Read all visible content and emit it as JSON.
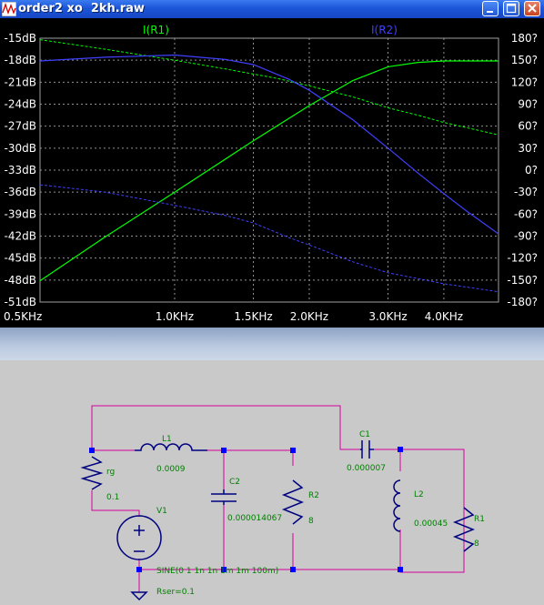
{
  "window": {
    "title": "order2 xo  2kh.raw",
    "icon": "waveform-icon",
    "accent": "#1c55d8"
  },
  "plot": {
    "trace_labels": [
      "I(R1)",
      "I(R2)"
    ],
    "trace_colors": {
      "I(R1)": "#00ff00",
      "I(R2)": "#4040ff"
    },
    "left_axis_labels": [
      "-15dB",
      "-18dB",
      "-21dB",
      "-24dB",
      "-27dB",
      "-30dB",
      "-33dB",
      "-36dB",
      "-39dB",
      "-42dB",
      "-45dB",
      "-48dB",
      "-51dB"
    ],
    "right_axis_labels": [
      "180?",
      "150?",
      "120?",
      "90?",
      "60?",
      "30?",
      "0?",
      "-30?",
      "-60?",
      "-90?",
      "-120?",
      "-150?",
      "-180?"
    ],
    "x_axis_labels": [
      "0.5KHz",
      "1.0KHz",
      "1.5KHz",
      "2.0KHz",
      "3.0KHz",
      "4.0KHz"
    ]
  },
  "schematic": {
    "labels": {
      "rg": "rg",
      "rg_value": "0.1",
      "l1": "L1",
      "l1_value": "0.0009",
      "c2": "C2",
      "c2_value": "0.000014067",
      "r2": "R2",
      "r2_value": "8",
      "c1": "C1",
      "c1_value": "0.000007",
      "l2": "L2",
      "l2_value": "0.00045",
      "r1": "R1",
      "r1_value": "8",
      "v1": "V1",
      "v1_source": "SINE(0 1 1n 1n 1m 1m 100m)",
      "v1_rser": "Rser=0.1"
    }
  },
  "chart_data": {
    "type": "line",
    "x_scale": "log",
    "x_ticks": [
      "0.5KHz",
      "1.0KHz",
      "1.5KHz",
      "2.0KHz",
      "3.0KHz",
      "4.0KHz"
    ],
    "xlim_hz": [
      500,
      5300
    ],
    "y_left_ticks_db": [
      -15,
      -18,
      -21,
      -24,
      -27,
      -30,
      -33,
      -36,
      -39,
      -42,
      -45,
      -48,
      -51
    ],
    "ylim_db": [
      -51,
      -15
    ],
    "y_right_ticks_deg": [
      180,
      150,
      120,
      90,
      60,
      30,
      0,
      -30,
      -60,
      -90,
      -120,
      -150,
      -180
    ],
    "ylim_deg": [
      -180,
      180
    ],
    "grid": true,
    "series": [
      {
        "name": "I(R1)",
        "color": "#00ff00",
        "magnitude_db": [
          [
            500,
            -48.1
          ],
          [
            700,
            -42.1
          ],
          [
            1000,
            -36.0
          ],
          [
            1500,
            -29.0
          ],
          [
            2000,
            -24.2
          ],
          [
            2500,
            -20.8
          ],
          [
            3000,
            -18.9
          ],
          [
            3500,
            -18.3
          ],
          [
            4000,
            -18.1
          ],
          [
            5300,
            -18.1
          ]
        ],
        "phase_deg": [
          [
            500,
            178
          ],
          [
            700,
            165
          ],
          [
            1000,
            150
          ],
          [
            1300,
            138
          ],
          [
            1700,
            125
          ],
          [
            2000,
            115
          ],
          [
            2500,
            100
          ],
          [
            3000,
            85
          ],
          [
            3500,
            75
          ],
          [
            4000,
            65
          ],
          [
            5300,
            48
          ]
        ]
      },
      {
        "name": "I(R2)",
        "color": "#4040ff",
        "magnitude_db": [
          [
            500,
            -18.1
          ],
          [
            700,
            -17.6
          ],
          [
            1000,
            -17.3
          ],
          [
            1300,
            -17.9
          ],
          [
            1500,
            -18.6
          ],
          [
            1800,
            -20.6
          ],
          [
            2000,
            -22.1
          ],
          [
            2500,
            -26.1
          ],
          [
            3000,
            -30.0
          ],
          [
            3500,
            -33.4
          ],
          [
            4000,
            -36.2
          ],
          [
            4500,
            -38.6
          ],
          [
            5300,
            -41.7
          ]
        ],
        "phase_deg": [
          [
            500,
            -20
          ],
          [
            700,
            -30
          ],
          [
            1000,
            -48
          ],
          [
            1300,
            -62
          ],
          [
            1500,
            -72
          ],
          [
            1800,
            -92
          ],
          [
            2000,
            -102
          ],
          [
            2500,
            -125
          ],
          [
            3000,
            -140
          ],
          [
            4000,
            -155
          ],
          [
            5300,
            -166
          ]
        ]
      }
    ]
  }
}
